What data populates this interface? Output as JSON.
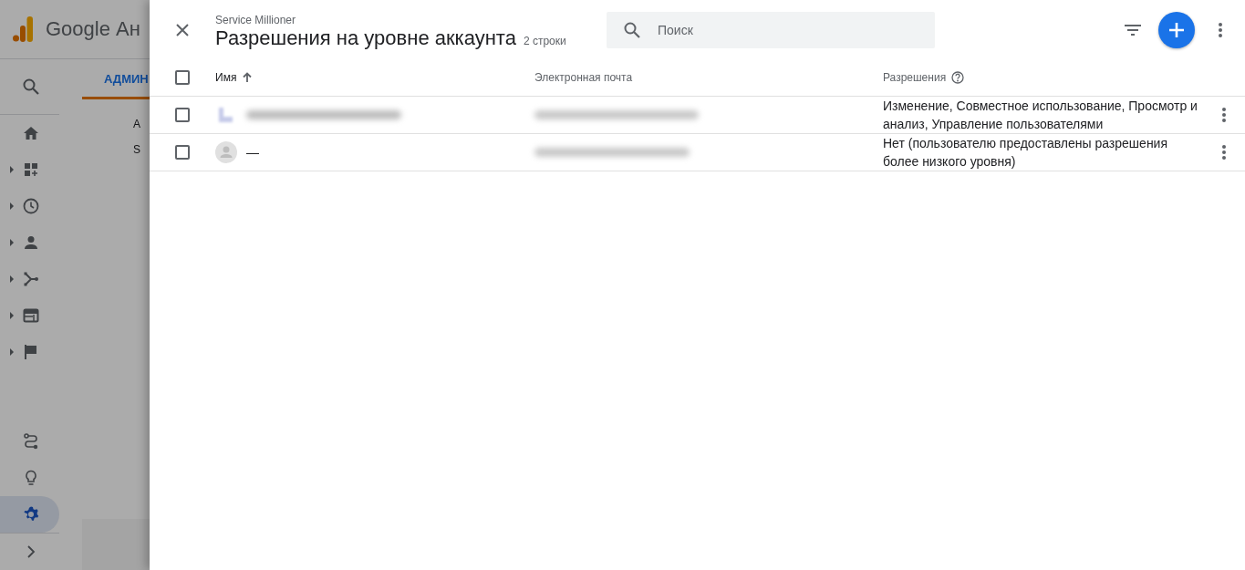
{
  "backdrop": {
    "product_name": "Google Ан",
    "tab": {
      "label": "АДМИН",
      "selected": true
    },
    "content_letters": [
      "А",
      "S"
    ],
    "nav_items": [
      {
        "kind": "search",
        "expander": false,
        "selected": false
      },
      {
        "kind": "home",
        "expander": false,
        "selected": false
      },
      {
        "kind": "dashboard",
        "expander": true,
        "selected": false
      },
      {
        "kind": "clock",
        "expander": true,
        "selected": false
      },
      {
        "kind": "person",
        "expander": true,
        "selected": false
      },
      {
        "kind": "fork",
        "expander": true,
        "selected": false
      },
      {
        "kind": "window",
        "expander": true,
        "selected": false
      },
      {
        "kind": "flag",
        "expander": true,
        "selected": false
      },
      {
        "kind": "route",
        "expander": false,
        "selected": false
      },
      {
        "kind": "bulb",
        "expander": false,
        "selected": false
      },
      {
        "kind": "gear",
        "expander": false,
        "selected": true
      },
      {
        "kind": "chevron",
        "expander": false,
        "selected": false
      }
    ]
  },
  "panel": {
    "account": "Service Millioner",
    "title": "Разрешения на уровне аккаунта",
    "row_count": "2 строки",
    "search": {
      "placeholder": "Поиск"
    },
    "table": {
      "select_all_checked": false,
      "columns": [
        {
          "label": "Имя",
          "sorted_ascending": true,
          "help": false
        },
        {
          "label": "Электронная почта",
          "sorted_ascending": false,
          "help": false
        },
        {
          "label": "Разрешения",
          "sorted_ascending": false,
          "help": true
        }
      ],
      "rows": [
        {
          "checked": false,
          "kind": "blurred",
          "permissions": "Изменение, Совместное использование, Просмотр и анализ, Управление пользователями"
        },
        {
          "checked": false,
          "kind": "person",
          "name": "—",
          "permissions": "Нет (пользователю предоставлены разрешения более низкого уровня)"
        }
      ]
    }
  }
}
